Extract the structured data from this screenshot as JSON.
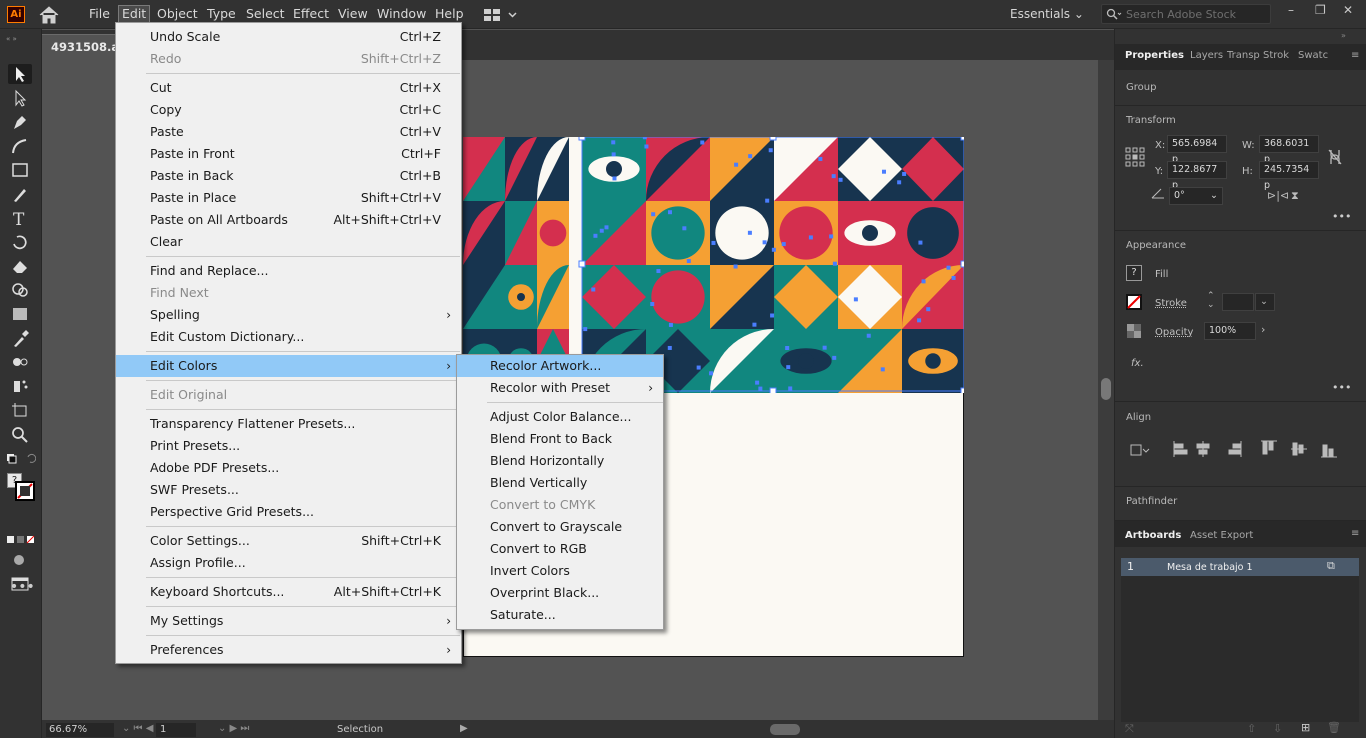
{
  "app": {
    "logo": "Ai",
    "doc_tab": "4931508.ai*"
  },
  "menubar": [
    "File",
    "Edit",
    "Object",
    "Type",
    "Select",
    "Effect",
    "View",
    "Window",
    "Help"
  ],
  "workspace": "Essentials",
  "search": {
    "placeholder": "Search Adobe Stock"
  },
  "edit_menu": [
    {
      "label": "Undo Scale",
      "shortcut": "Ctrl+Z"
    },
    {
      "label": "Redo",
      "shortcut": "Shift+Ctrl+Z",
      "disabled": true
    },
    {
      "sep": true
    },
    {
      "label": "Cut",
      "shortcut": "Ctrl+X"
    },
    {
      "label": "Copy",
      "shortcut": "Ctrl+C"
    },
    {
      "label": "Paste",
      "shortcut": "Ctrl+V"
    },
    {
      "label": "Paste in Front",
      "shortcut": "Ctrl+F"
    },
    {
      "label": "Paste in Back",
      "shortcut": "Ctrl+B"
    },
    {
      "label": "Paste in Place",
      "shortcut": "Shift+Ctrl+V"
    },
    {
      "label": "Paste on All Artboards",
      "shortcut": "Alt+Shift+Ctrl+V"
    },
    {
      "label": "Clear",
      "shortcut": ""
    },
    {
      "sep": true
    },
    {
      "label": "Find and Replace...",
      "shortcut": ""
    },
    {
      "label": "Find Next",
      "shortcut": "",
      "disabled": true
    },
    {
      "label": "Spelling",
      "shortcut": "",
      "arrow": true
    },
    {
      "label": "Edit Custom Dictionary...",
      "shortcut": ""
    },
    {
      "sep": true
    },
    {
      "label": "Edit Colors",
      "shortcut": "",
      "arrow": true,
      "highlight": true
    },
    {
      "sep": true
    },
    {
      "label": "Edit Original",
      "shortcut": "",
      "disabled": true
    },
    {
      "sep": true
    },
    {
      "label": "Transparency Flattener Presets...",
      "shortcut": ""
    },
    {
      "label": "Print Presets...",
      "shortcut": ""
    },
    {
      "label": "Adobe PDF Presets...",
      "shortcut": ""
    },
    {
      "label": "SWF Presets...",
      "shortcut": ""
    },
    {
      "label": "Perspective Grid Presets...",
      "shortcut": ""
    },
    {
      "sep": true
    },
    {
      "label": "Color Settings...",
      "shortcut": "Shift+Ctrl+K"
    },
    {
      "label": "Assign Profile...",
      "shortcut": ""
    },
    {
      "sep": true
    },
    {
      "label": "Keyboard Shortcuts...",
      "shortcut": "Alt+Shift+Ctrl+K"
    },
    {
      "sep": true
    },
    {
      "label": "My Settings",
      "shortcut": "",
      "arrow": true
    },
    {
      "sep": true
    },
    {
      "label": "Preferences",
      "shortcut": "",
      "arrow": true
    }
  ],
  "edit_colors_menu": [
    {
      "label": "Recolor Artwork...",
      "highlight": true
    },
    {
      "label": "Recolor with Preset",
      "arrow": true
    },
    {
      "sep": true
    },
    {
      "label": "Adjust Color Balance..."
    },
    {
      "label": "Blend Front to Back"
    },
    {
      "label": "Blend Horizontally"
    },
    {
      "label": "Blend Vertically"
    },
    {
      "label": "Convert to CMYK",
      "disabled": true
    },
    {
      "label": "Convert to Grayscale"
    },
    {
      "label": "Convert to RGB"
    },
    {
      "label": "Invert Colors"
    },
    {
      "label": "Overprint Black..."
    },
    {
      "label": "Saturate..."
    }
  ],
  "properties": {
    "tabs": [
      "Properties",
      "Layers",
      "Transp",
      "Strok",
      "Swatc"
    ],
    "group_label": "Group",
    "transform_title": "Transform",
    "x_label": "X:",
    "x": "565.6984 p",
    "y_label": "Y:",
    "y": "122.8677 p",
    "w_label": "W:",
    "w": "368.6031 p",
    "h_label": "H:",
    "h": "245.7354 p",
    "angle": "0°",
    "appearance_title": "Appearance",
    "fill_label": "Fill",
    "stroke_label": "Stroke",
    "opacity_label": "Opacity",
    "opacity": "100%",
    "fx_label": "fx.",
    "align_title": "Align",
    "pathfinder_title": "Pathfinder"
  },
  "artboards": {
    "tabs": [
      "Artboards",
      "Asset Export"
    ],
    "rows": [
      {
        "num": "1",
        "name": "Mesa de trabajo 1"
      }
    ]
  },
  "status": {
    "zoom": "66.67%",
    "page": "1",
    "tool": "Selection"
  },
  "colors": {
    "navy": "#17344f",
    "teal": "#11877f",
    "red": "#d42f4e",
    "orange": "#f5a033",
    "cream": "#fbf9f3",
    "selection": "#4a7eff"
  }
}
